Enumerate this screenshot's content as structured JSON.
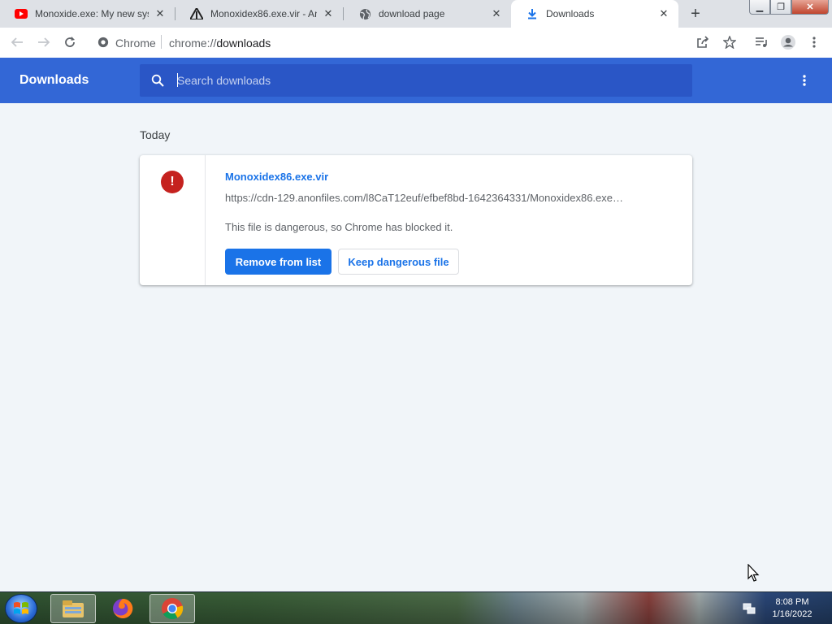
{
  "browser": {
    "tabs": [
      {
        "title": "Monoxide.exe: My new sys",
        "icon": "youtube-icon",
        "active": false
      },
      {
        "title": "Monoxidex86.exe.vir - Ano",
        "icon": "anonfiles-icon",
        "active": false
      },
      {
        "title": "download page",
        "icon": "globe-icon",
        "active": false
      },
      {
        "title": "Downloads",
        "icon": "download-icon",
        "active": true
      }
    ],
    "omnibox": {
      "site_label": "Chrome",
      "url_scheme": "chrome://",
      "url_host": "downloads"
    }
  },
  "downloads_page": {
    "title": "Downloads",
    "search_placeholder": "Search downloads",
    "date_group": "Today",
    "item": {
      "file_name": "Monoxidex86.exe.vir",
      "url": "https://cdn-129.anonfiles.com/l8CaT12euf/efbef8bd-1642364331/Monoxidex86.exe…",
      "description": "This file is dangerous, so Chrome has blocked it.",
      "remove_label": "Remove from list",
      "keep_label": "Keep dangerous file"
    }
  },
  "taskbar": {
    "time": "8:08 PM",
    "date": "1/16/2022"
  },
  "colors": {
    "header_blue": "#3367d6",
    "search_blue": "#2a56c6",
    "accent_blue": "#1a73e8",
    "danger_red": "#c5221f"
  }
}
